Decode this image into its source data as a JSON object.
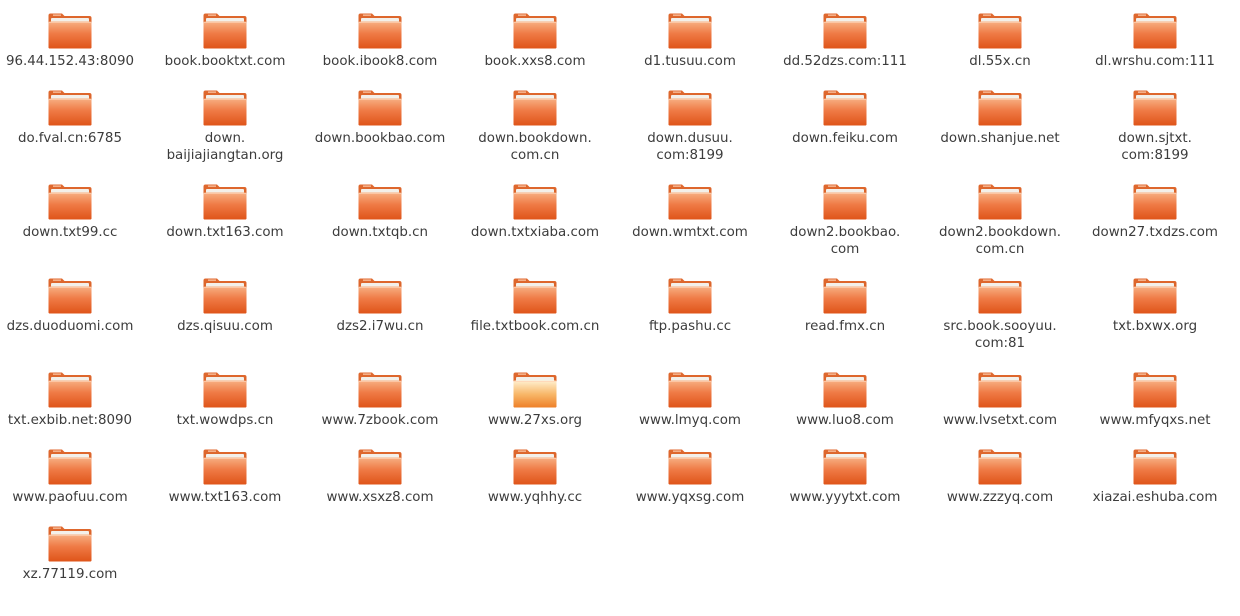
{
  "view": "file-manager-icon-view",
  "folder_colors": {
    "back": "#d85a1f",
    "front_top": "#f6a877",
    "front_bottom": "#e2561b",
    "paper": "#f3f0ea",
    "front_open_top": "#fde4b8",
    "front_open_bottom": "#f08a32"
  },
  "folders": [
    {
      "label": "96.44.152.43:8090"
    },
    {
      "label": "book.booktxt.com"
    },
    {
      "label": "book.ibook8.com"
    },
    {
      "label": "book.xxs8.com"
    },
    {
      "label": "d1.tusuu.com"
    },
    {
      "label": "dd.52dzs.com:111"
    },
    {
      "label": "dl.55x.cn"
    },
    {
      "label": "dl.wrshu.com:111"
    },
    {
      "label": "do.fval.cn:6785"
    },
    {
      "label": "down.\nbaijiajiangtan.org"
    },
    {
      "label": "down.bookbao.com"
    },
    {
      "label": "down.bookdown.\ncom.cn"
    },
    {
      "label": "down.dusuu.\ncom:8199"
    },
    {
      "label": "down.feiku.com"
    },
    {
      "label": "down.shanjue.net"
    },
    {
      "label": "down.sjtxt.\ncom:8199"
    },
    {
      "label": "down.txt99.cc"
    },
    {
      "label": "down.txt163.com"
    },
    {
      "label": "down.txtqb.cn"
    },
    {
      "label": "down.txtxiaba.com"
    },
    {
      "label": "down.wmtxt.com"
    },
    {
      "label": "down2.bookbao.\ncom"
    },
    {
      "label": "down2.bookdown.\ncom.cn"
    },
    {
      "label": "down27.txdzs.com"
    },
    {
      "label": "dzs.duoduomi.com"
    },
    {
      "label": "dzs.qisuu.com"
    },
    {
      "label": "dzs2.i7wu.cn"
    },
    {
      "label": "file.txtbook.com.cn"
    },
    {
      "label": "ftp.pashu.cc"
    },
    {
      "label": "read.fmx.cn"
    },
    {
      "label": "src.book.sooyuu.\ncom:81"
    },
    {
      "label": "txt.bxwx.org"
    },
    {
      "label": "txt.exbib.net:8090"
    },
    {
      "label": "txt.wowdps.cn"
    },
    {
      "label": "www.7zbook.com"
    },
    {
      "label": "www.27xs.org",
      "state": "open"
    },
    {
      "label": "www.lmyq.com"
    },
    {
      "label": "www.luo8.com"
    },
    {
      "label": "www.lvsetxt.com"
    },
    {
      "label": "www.mfyqxs.net"
    },
    {
      "label": "www.paofuu.com"
    },
    {
      "label": "www.txt163.com"
    },
    {
      "label": "www.xsxz8.com"
    },
    {
      "label": "www.yqhhy.cc"
    },
    {
      "label": "www.yqxsg.com"
    },
    {
      "label": "www.yyytxt.com"
    },
    {
      "label": "www.zzzyq.com"
    },
    {
      "label": "xiazai.eshuba.com"
    },
    {
      "label": "xz.77119.com"
    }
  ]
}
